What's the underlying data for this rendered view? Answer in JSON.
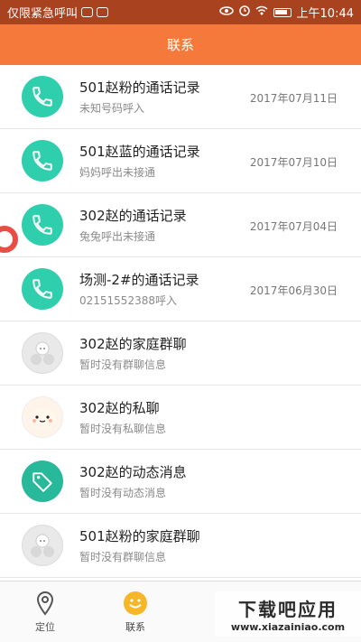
{
  "status_bar": {
    "left_text": "仅限紧急呼叫",
    "time": "上午10:44"
  },
  "header": {
    "title": "联系"
  },
  "list": [
    {
      "title": "501赵粉的通话记录",
      "sub": "未知号码呼入",
      "date": "2017年07月11日",
      "icon": "phone-icon"
    },
    {
      "title": "501赵蓝的通话记录",
      "sub": "妈妈呼出未接通",
      "date": "2017年07月10日",
      "icon": "phone-icon"
    },
    {
      "title": "302赵的通话记录",
      "sub": "兔兔呼出未接通",
      "date": "2017年07月04日",
      "icon": "phone-icon"
    },
    {
      "title": "场测-2#的通话记录",
      "sub": "02151552388呼入",
      "date": "2017年06月30日",
      "icon": "phone-icon"
    },
    {
      "title": "302赵的家庭群聊",
      "sub": "暂时没有群聊信息",
      "date": "",
      "icon": "group-avatar-icon"
    },
    {
      "title": "302赵的私聊",
      "sub": "暂时没有私聊信息",
      "date": "",
      "icon": "bear-avatar-icon"
    },
    {
      "title": "302赵的动态消息",
      "sub": "暂时没有动态消息",
      "date": "",
      "icon": "tag-icon"
    },
    {
      "title": "501赵粉的家庭群聊",
      "sub": "暂时没有群聊信息",
      "date": "",
      "icon": "group-avatar-icon"
    }
  ],
  "tabbar": {
    "tabs": [
      {
        "label": "定位",
        "icon": "location-pin-icon"
      },
      {
        "label": "联系",
        "icon": "smiley-icon"
      }
    ]
  },
  "watermark": {
    "big": "下载吧应用",
    "small": "www.xiazainiao.com"
  },
  "colors": {
    "header": "#f4793b",
    "status_bar": "#a9421f",
    "teal": "#2fcfae",
    "accent_yellow": "#f6b627"
  }
}
